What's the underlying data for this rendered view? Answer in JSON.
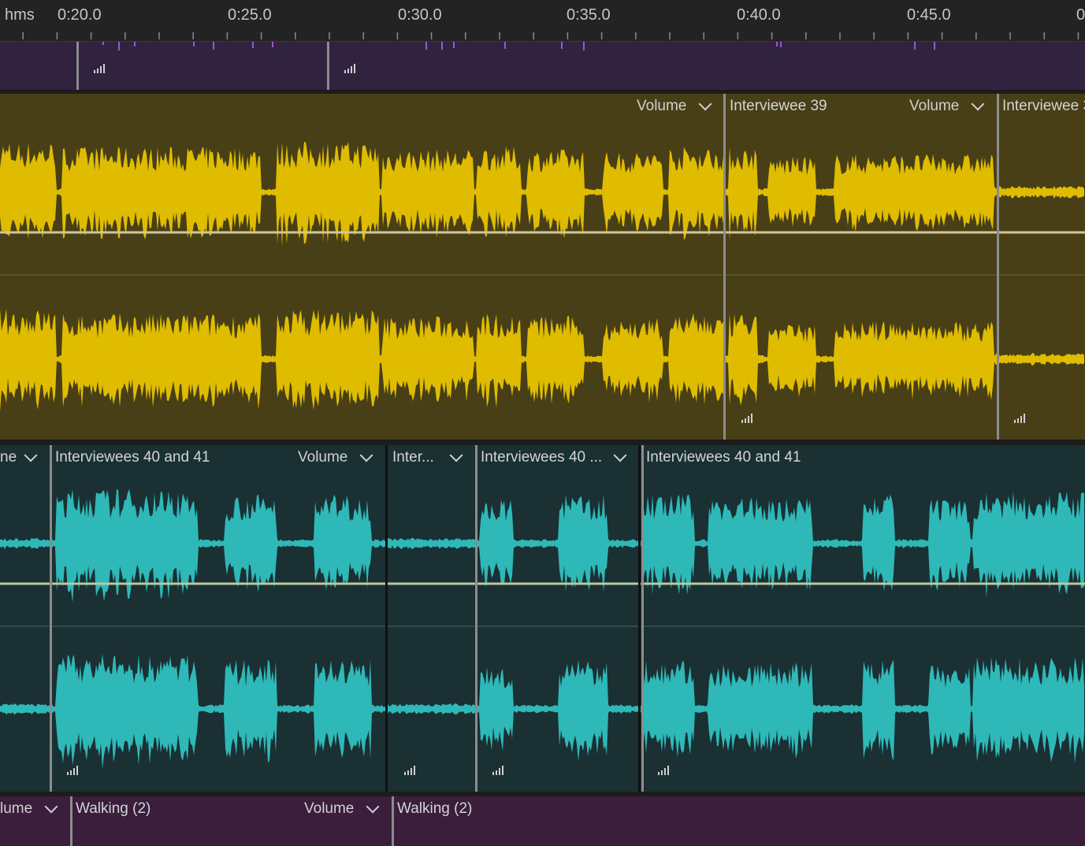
{
  "ruler": {
    "unit_label": "hms",
    "ticks": [
      "0:20.0",
      "0:25.0",
      "0:30.0",
      "0:35.0",
      "0:40.0",
      "0:45.0",
      "0"
    ]
  },
  "tracks": {
    "music": {
      "color": "#31223f",
      "wave_color": "#9b59d0"
    },
    "voice_a": {
      "color": "#483f17",
      "wave_color": "#dfbc00",
      "clip_labels": [
        "Interviewee 39",
        "Interviewee 3"
      ],
      "volume_labels": [
        "Volume",
        "Volume"
      ]
    },
    "voice_b": {
      "color": "#1a3033",
      "wave_color": "#2fb8b8",
      "clip_labels": [
        "ne",
        "Interviewees 40 and 41",
        "Inter...",
        "Interviewees 40 ...",
        "Interviewees 40 and 41"
      ],
      "volume_labels": [
        "Volume"
      ]
    },
    "fx": {
      "color": "#3a1e3c",
      "clip_labels": [
        "Walking (2)",
        "Walking (2)"
      ],
      "volume_labels": [
        "lume",
        "Volume"
      ]
    }
  }
}
